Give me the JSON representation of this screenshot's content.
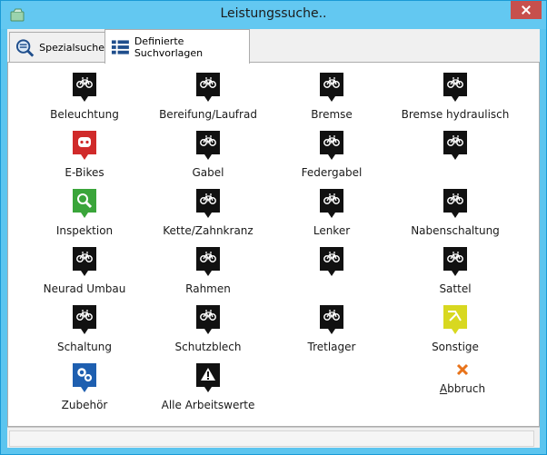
{
  "window": {
    "title": "Leistungssuche.."
  },
  "tabs": [
    {
      "label": "Spezialsuche"
    },
    {
      "label": "Definierte Suchvorlagen"
    }
  ],
  "items": [
    {
      "label": "Beleuchtung",
      "icon": "bike-pin-icon"
    },
    {
      "label": "Bereifung/Laufrad",
      "icon": "bike-pin-icon"
    },
    {
      "label": "Bremse",
      "icon": "bike-pin-icon"
    },
    {
      "label": "Bremse hydraulisch",
      "icon": "bike-pin-icon"
    },
    {
      "label": "E-Bikes",
      "icon": "ebike-pin-icon",
      "color": "#d02a2a"
    },
    {
      "label": "Gabel",
      "icon": "bike-pin-icon"
    },
    {
      "label": "Federgabel",
      "icon": "bike-pin-icon"
    },
    {
      "label": "",
      "icon": "bike-pin-icon"
    },
    {
      "label": "Inspektion",
      "icon": "magnifier-pin-icon",
      "color": "#3aa53a"
    },
    {
      "label": "Kette/Zahnkranz",
      "icon": "bike-pin-icon"
    },
    {
      "label": "Lenker",
      "icon": "bike-pin-icon"
    },
    {
      "label": "Nabenschaltung",
      "icon": "bike-pin-icon"
    },
    {
      "label": "Neurad Umbau",
      "icon": "bike-pin-icon"
    },
    {
      "label": "Rahmen",
      "icon": "bike-pin-icon"
    },
    {
      "label": "",
      "icon": "bike-pin-icon"
    },
    {
      "label": "Sattel",
      "icon": "bike-pin-icon"
    },
    {
      "label": "Schaltung",
      "icon": "bike-pin-icon"
    },
    {
      "label": "Schutzblech",
      "icon": "bike-pin-icon"
    },
    {
      "label": "Tretlager",
      "icon": "bike-pin-icon"
    },
    {
      "label": "Sonstige",
      "icon": "tools-pin-icon",
      "color": "#d8d820"
    },
    {
      "label": "Zubehör",
      "icon": "gears-pin-icon",
      "color": "#1e5fb0"
    },
    {
      "label": "Alle Arbeitswerte",
      "icon": "warning-pin-icon"
    }
  ],
  "cancel": {
    "prefix": "A",
    "rest": "bbruch",
    "icon": "close-x-icon",
    "color": "#e8731a"
  }
}
